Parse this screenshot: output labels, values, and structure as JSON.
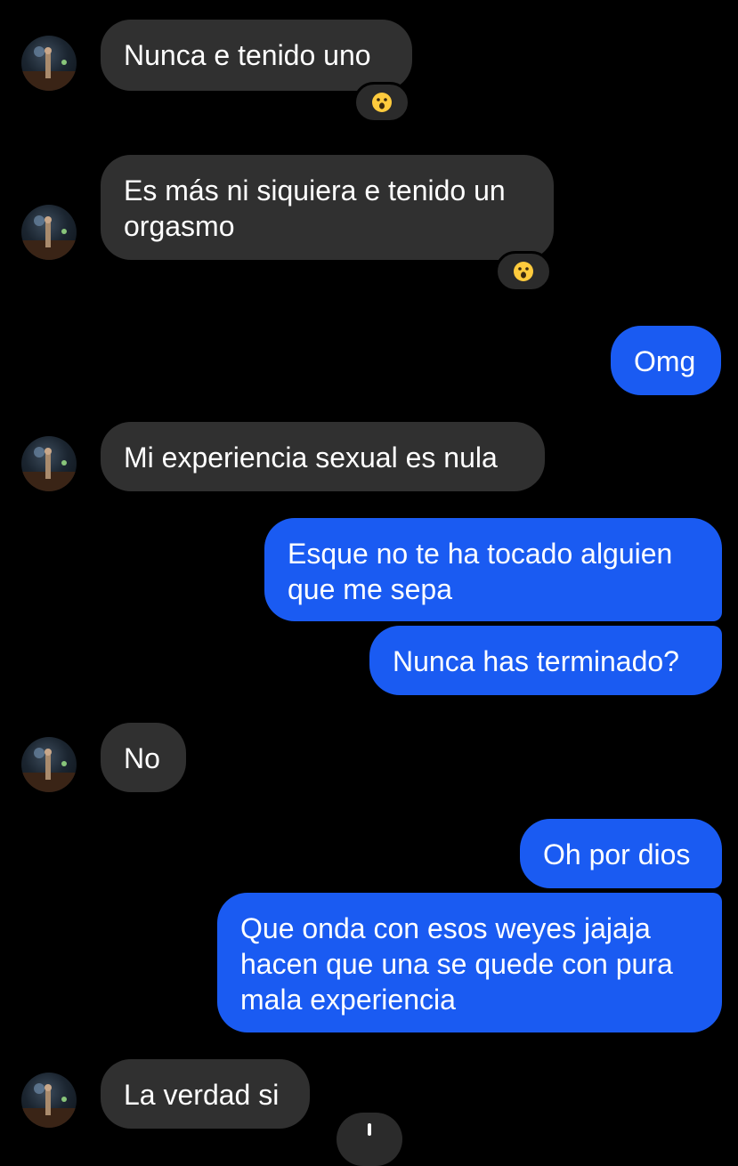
{
  "colors": {
    "background": "#000000",
    "incoming_bubble": "#303030",
    "outgoing_bubble": "#1a5bf2",
    "text": "#ffffff"
  },
  "messages": [
    {
      "direction": "incoming",
      "text": "Nunca e tenido uno",
      "reaction": "astonished-face-emoji"
    },
    {
      "direction": "incoming",
      "text": "Es más ni siquiera e tenido un\norgasmo",
      "reaction": "astonished-face-emoji"
    },
    {
      "direction": "outgoing",
      "text": "Omg"
    },
    {
      "direction": "incoming",
      "text": "Mi experiencia sexual es nula"
    },
    {
      "direction": "outgoing",
      "text": "Esque no te ha tocado alguien\nque me sepa"
    },
    {
      "direction": "outgoing",
      "text": "Nunca has terminado?"
    },
    {
      "direction": "incoming",
      "text": "No"
    },
    {
      "direction": "outgoing",
      "text": "Oh por dios"
    },
    {
      "direction": "outgoing",
      "text": "Que onda con esos weyes jajaja\nhacen que una se quede con pura\nmala experiencia"
    },
    {
      "direction": "incoming",
      "text": "La verdad si",
      "reaction": "partially-visible-reaction"
    }
  ]
}
